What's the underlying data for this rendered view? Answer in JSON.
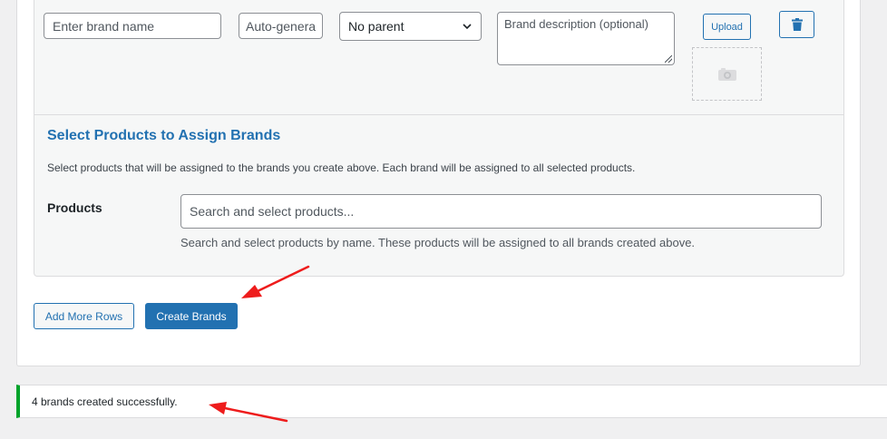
{
  "brand_row": {
    "name_placeholder": "Enter brand name",
    "slug_placeholder": "Auto-genera",
    "parent_selected": "No parent",
    "description_placeholder": "Brand description (optional)",
    "upload_label": "Upload"
  },
  "assign": {
    "title": "Select Products to Assign Brands",
    "description": "Select products that will be assigned to the brands you create above. Each brand will be assigned to all selected products.",
    "products_label": "Products",
    "products_placeholder": "Search and select products...",
    "products_help": "Search and select products by name. These products will be assigned to all brands created above."
  },
  "actions": {
    "add_rows_label": "Add More Rows",
    "create_label": "Create Brands"
  },
  "notice": {
    "message": "4 brands created successfully.",
    "status_color": "#00a32a"
  },
  "colors": {
    "accent": "#2271b1",
    "annotation_arrow": "#ee1c1c"
  },
  "icons": {
    "select_arrow": "chevron-down-icon",
    "delete": "trash-icon",
    "image_placeholder": "camera-icon"
  }
}
